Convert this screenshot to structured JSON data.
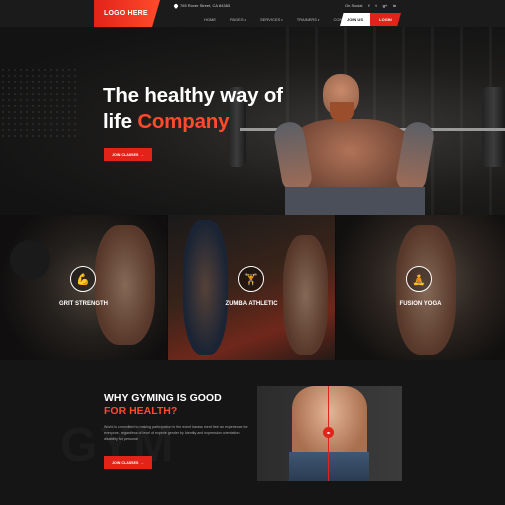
{
  "header": {
    "logo": "LOGO HERE",
    "address": "765 Rover Street, CA 84383",
    "social_label": "On Social",
    "social_icons": [
      "f",
      "t",
      "g+",
      "in"
    ],
    "nav": [
      "HOME",
      "PAGES",
      "SERVICES",
      "TRAINERS",
      "CONTACT"
    ],
    "join_label": "JOIN US",
    "login_label": "LOGIN"
  },
  "hero": {
    "title_line1": "The healthy way of",
    "title_line2_a": "life ",
    "title_line2_b": "Company",
    "button_label": "JOIN CLASSES",
    "button_arrow": "→"
  },
  "cards": [
    {
      "label": "GRIT STRENGTH",
      "icon": "💪"
    },
    {
      "label": "ZUMBA ATHLETIC",
      "icon": "🏋"
    },
    {
      "label": "FUSION YOGA",
      "icon": "🧘"
    }
  ],
  "about": {
    "title_line1": "WHY GYMING IS GOOD",
    "title_line2": "FOR HEALTH?",
    "paragraph": "World is committed to making participation in the event harass ment free an experience for everyone, regardless of level of experie gender by Identity and expression orientation disability for personal",
    "button_label": "JOIN CLASSES",
    "button_arrow": "→",
    "watermark": "GYM",
    "compare_icon": "◂▸"
  },
  "colors": {
    "accent": "#e2231a",
    "accent_light": "#ff4b2b",
    "bg": "#141414"
  }
}
